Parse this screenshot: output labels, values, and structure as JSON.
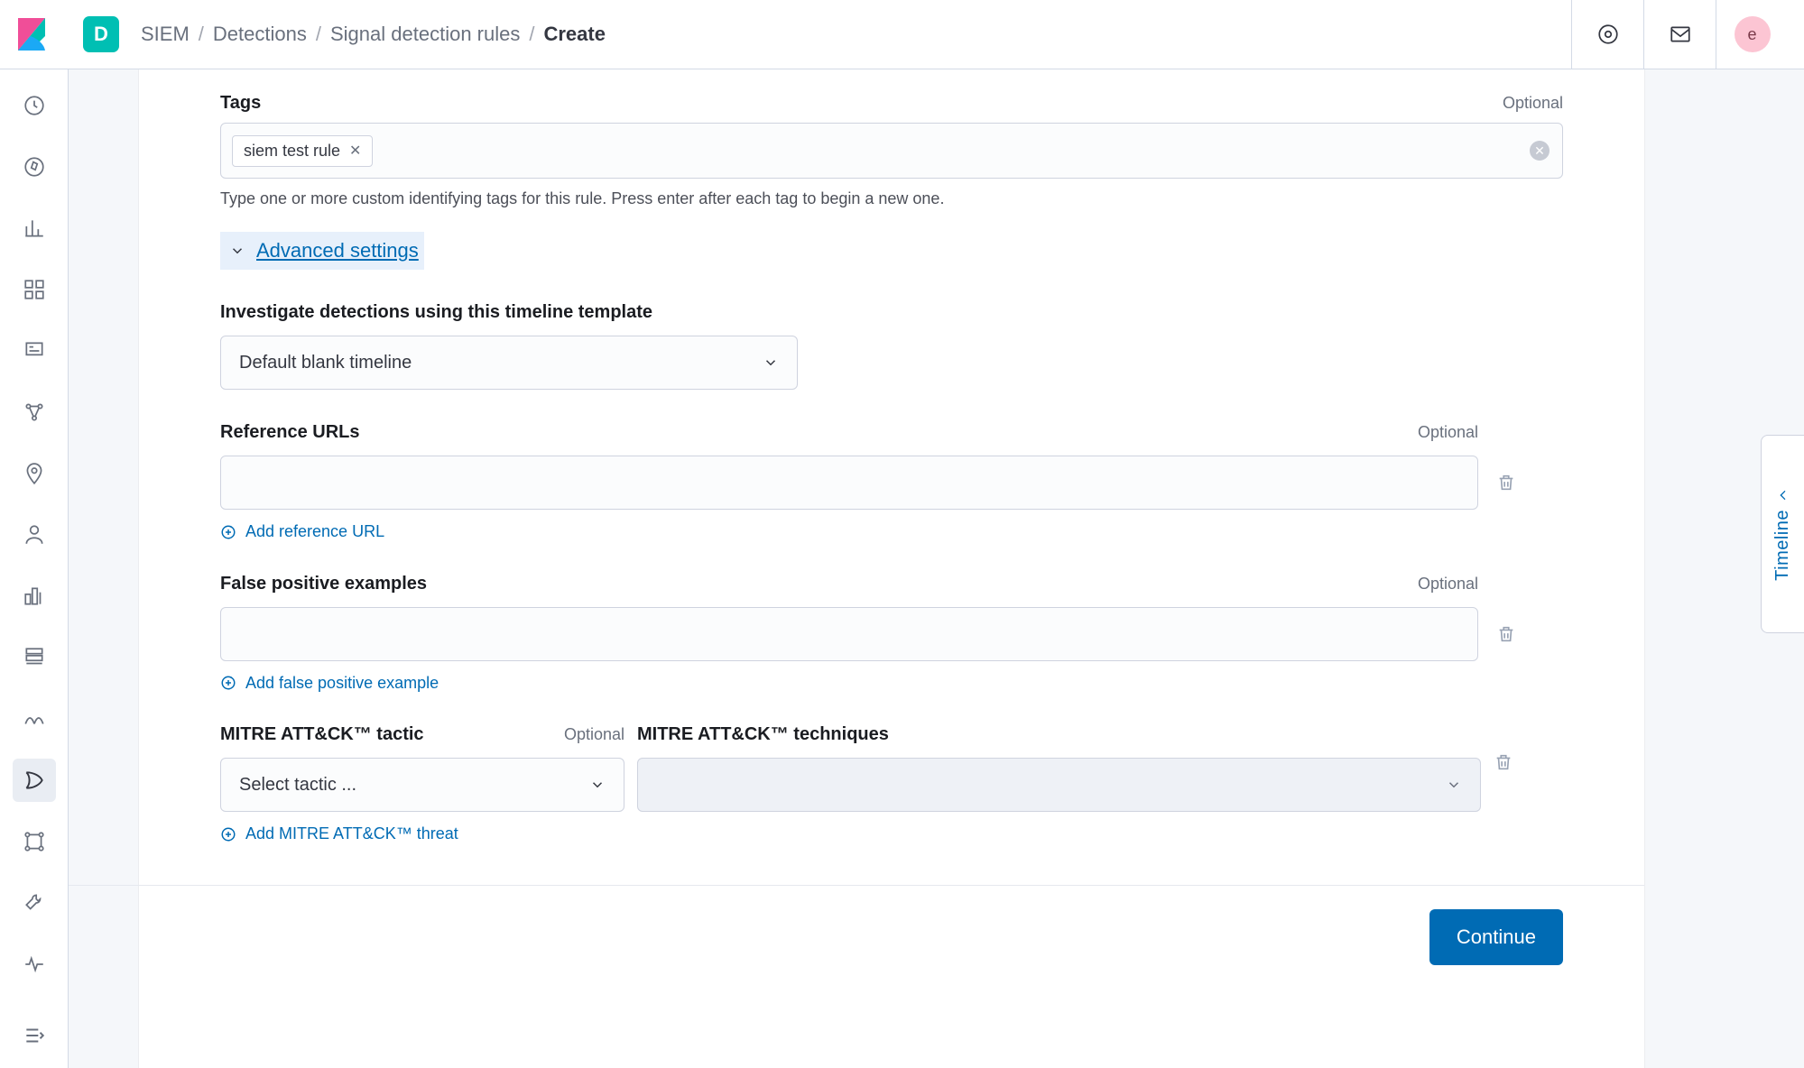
{
  "header": {
    "app_badge": "D",
    "user_initial": "e",
    "breadcrumbs": [
      "SIEM",
      "Detections",
      "Signal detection rules",
      "Create"
    ]
  },
  "form": {
    "tags_label": "Tags",
    "tags_optional": "Optional",
    "tags_values": [
      "siem test rule"
    ],
    "tags_helper": "Type one or more custom identifying tags for this rule. Press enter after each tag to begin a new one.",
    "advanced_settings_label": "Advanced settings",
    "timeline_label": "Investigate detections using this timeline template",
    "timeline_value": "Default blank timeline",
    "reference_label": "Reference URLs",
    "reference_optional": "Optional",
    "add_reference_label": "Add reference URL",
    "falsepos_label": "False positive examples",
    "falsepos_optional": "Optional",
    "add_falsepos_label": "Add false positive example",
    "mitre_tactic_label": "MITRE ATT&CK™ tactic",
    "mitre_tactic_optional": "Optional",
    "mitre_tactic_placeholder": "Select tactic ...",
    "mitre_tech_label": "MITRE ATT&CK™ techniques",
    "add_mitre_label": "Add MITRE ATT&CK™ threat",
    "continue_label": "Continue"
  },
  "timeline_tab": "Timeline"
}
